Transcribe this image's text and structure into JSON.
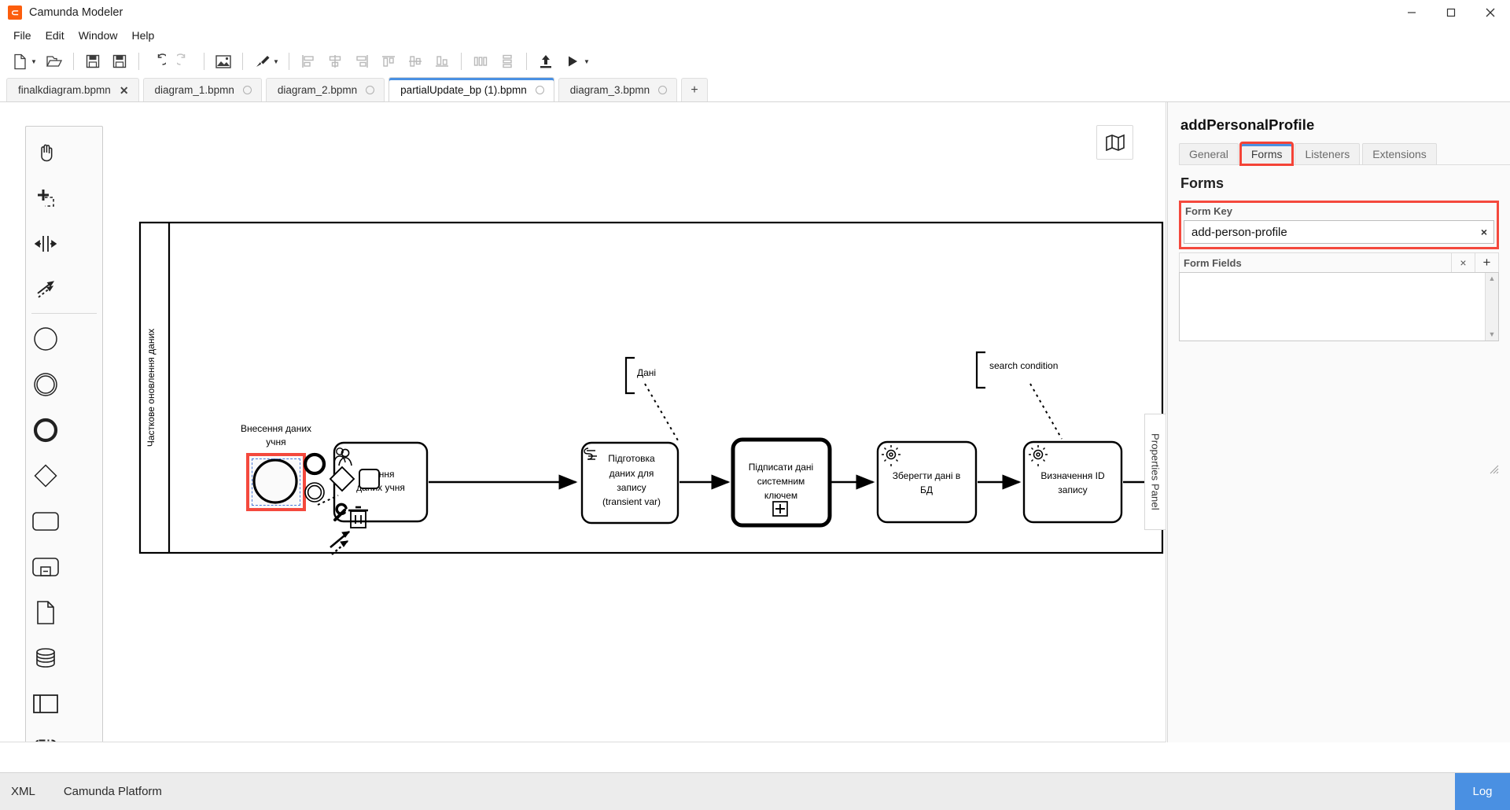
{
  "window": {
    "app_title": "Camunda Modeler",
    "logo_icon": "camunda-logo-icon",
    "minimize_icon": "minimize-icon",
    "maximize_icon": "maximize-icon",
    "close_icon": "close-icon"
  },
  "menubar": [
    {
      "label": "File"
    },
    {
      "label": "Edit"
    },
    {
      "label": "Window"
    },
    {
      "label": "Help"
    }
  ],
  "toolbar": [
    {
      "name": "new-file-button",
      "icon": "new-file-icon",
      "caret": true
    },
    {
      "name": "open-file-button",
      "icon": "open-folder-icon",
      "caret": false
    },
    {
      "name": "save-button",
      "icon": "save-icon",
      "caret": false
    },
    {
      "name": "save-as-button",
      "icon": "save-as-icon",
      "caret": false
    },
    {
      "name": "undo-button",
      "icon": "undo-icon",
      "caret": false
    },
    {
      "name": "redo-button",
      "icon": "redo-icon",
      "caret": false
    },
    {
      "name": "export-image-button",
      "icon": "image-icon",
      "caret": false
    },
    {
      "name": "align-tool-button",
      "icon": "brush-icon",
      "caret": true
    },
    {
      "name": "align-left-button",
      "icon": "align-left-icon",
      "caret": false
    },
    {
      "name": "align-center-button",
      "icon": "align-center-icon",
      "caret": false
    },
    {
      "name": "align-right-button",
      "icon": "align-right-icon",
      "caret": false
    },
    {
      "name": "align-top-button",
      "icon": "align-top-icon",
      "caret": false
    },
    {
      "name": "align-middle-button",
      "icon": "align-middle-icon",
      "caret": false
    },
    {
      "name": "align-bottom-button",
      "icon": "align-bottom-icon",
      "caret": false
    },
    {
      "name": "distribute-horizontal-button",
      "icon": "distribute-horizontal-icon",
      "caret": false
    },
    {
      "name": "distribute-vertical-button",
      "icon": "distribute-vertical-icon",
      "caret": false
    },
    {
      "name": "deploy-button",
      "icon": "deploy-upload-icon",
      "caret": false
    },
    {
      "name": "run-button",
      "icon": "play-icon",
      "caret": true
    }
  ],
  "tabs": [
    {
      "label": "finalkdiagram.bpmn",
      "state": "close",
      "active": false
    },
    {
      "label": "diagram_1.bpmn",
      "state": "dot",
      "active": false
    },
    {
      "label": "diagram_2.bpmn",
      "state": "dot",
      "active": false
    },
    {
      "label": "partialUpdate_bp (1).bpmn",
      "state": "dot",
      "active": true
    },
    {
      "label": "diagram_3.bpmn",
      "state": "dot",
      "active": false
    }
  ],
  "tab_add_label": "+",
  "palette": {
    "rows": [
      [
        {
          "name": "hand-tool-icon",
          "label": "Activate the hand tool"
        },
        {
          "name": "lasso-tool-icon",
          "label": "Activate the lasso tool"
        }
      ],
      [
        {
          "name": "space-tool-icon",
          "label": "Activate the create/remove space tool"
        },
        {
          "name": "global-connect-tool-icon",
          "label": "Activate the global connect tool"
        }
      ],
      [
        {
          "name": "start-event-icon",
          "label": "Create StartEvent"
        },
        {
          "name": "intermediate-event-icon",
          "label": "Create Intermediate/Boundary Event"
        }
      ],
      [
        {
          "name": "end-event-icon",
          "label": "Create EndEvent"
        },
        {
          "name": "gateway-icon",
          "label": "Create Gateway"
        }
      ],
      [
        {
          "name": "task-icon",
          "label": "Create Task"
        },
        {
          "name": "subprocess-icon",
          "label": "Create expanded SubProcess"
        }
      ],
      [
        {
          "name": "data-object-icon",
          "label": "Create DataObjectReference"
        },
        {
          "name": "data-store-icon",
          "label": "Create DataStoreReference"
        }
      ],
      [
        {
          "name": "participant-icon",
          "label": "Create Pool/Participant"
        },
        {
          "name": "group-icon",
          "label": "Create Group"
        }
      ]
    ]
  },
  "canvas": {
    "minimap_icon": "map-icon",
    "properties_panel_toggle": "Properties Panel",
    "pool_label": "Часткове оновлення даних",
    "start_event": {
      "label": "Внесення даних учня",
      "selected": true
    },
    "context_pad": [
      "user-task-icon",
      "gateway-icon",
      "task-icon",
      "wrench-icon",
      "trash-icon",
      "connect-icon",
      "append-event-icon",
      "append-intermediate-icon"
    ],
    "tasks": [
      {
        "name": "user-task",
        "label": "...ісання даних учня",
        "marker": "user-icon"
      },
      {
        "name": "script-task",
        "label": "Підготовка даних для запису (transient var)",
        "marker": "script-icon"
      },
      {
        "name": "call-activity",
        "label": "Підписати дані системним ключем",
        "marker": "plus-icon"
      },
      {
        "name": "service-task-save",
        "label": "Зберегти дані в БД",
        "marker": "gear-icon"
      },
      {
        "name": "service-task-id",
        "label": "Визначення ID запису",
        "marker": "gear-icon"
      }
    ],
    "annotations": [
      {
        "name": "data-annotation",
        "label": "Дані"
      },
      {
        "name": "search-condition-annotation",
        "label": "search condition"
      }
    ]
  },
  "properties": {
    "title": "addPersonalProfile",
    "tabs": [
      {
        "label": "General",
        "active": false
      },
      {
        "label": "Forms",
        "active": true
      },
      {
        "label": "Listeners",
        "active": false
      },
      {
        "label": "Extensions",
        "active": false
      }
    ],
    "section_heading": "Forms",
    "form_key": {
      "label": "Form Key",
      "value": "add-person-profile",
      "clear_icon": "×"
    },
    "form_fields": {
      "label": "Form Fields",
      "remove_icon": "×",
      "add_icon": "+",
      "items": []
    },
    "highlight_color": "#f4493d",
    "accent_color": "#4a90e2"
  },
  "statusbar": {
    "items": [
      {
        "name": "xml-tab",
        "label": "XML"
      },
      {
        "name": "platform-label",
        "label": "Camunda Platform"
      }
    ],
    "log_label": "Log"
  }
}
